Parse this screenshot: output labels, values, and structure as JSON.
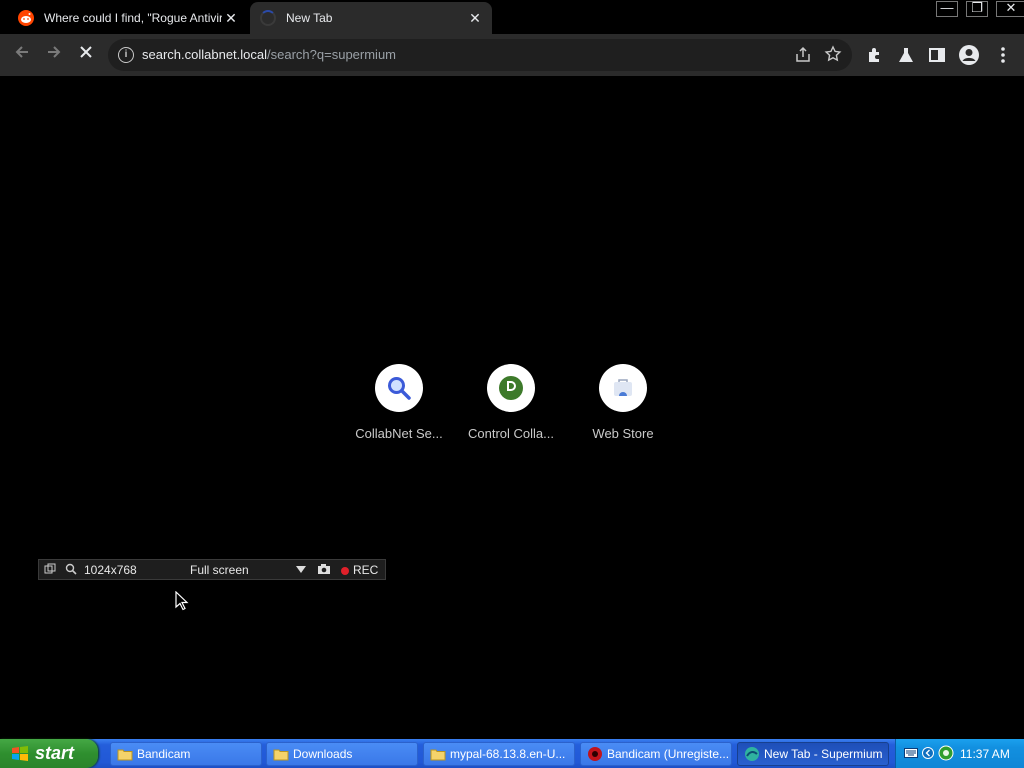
{
  "tabs": [
    {
      "title": "Where could I find, \"Rogue Antiviru",
      "close": "✕",
      "favicon": "reddit-icon"
    },
    {
      "title": "New Tab",
      "close": "✕",
      "favicon": "loading-spinner"
    }
  ],
  "window_controls": {
    "minimize": "—",
    "restore": "❐",
    "close": "✕"
  },
  "omnibox": {
    "domain": "search.collabnet.local",
    "path": "/search?q=supermium"
  },
  "shortcuts": [
    {
      "label": "CollabNet Se...",
      "icon": "search-icon"
    },
    {
      "label": "Control Colla...",
      "icon": "d-logo-icon"
    },
    {
      "label": "Web Store",
      "icon": "web-store-icon"
    }
  ],
  "bandicam": {
    "resolution": "1024x768",
    "mode": "Full screen",
    "rec": "REC"
  },
  "taskbar": {
    "start": "start",
    "items": [
      {
        "label": "Bandicam",
        "icon": "folder-icon"
      },
      {
        "label": "Downloads",
        "icon": "folder-icon"
      },
      {
        "label": "mypal-68.13.8.en-U...",
        "icon": "folder-icon"
      },
      {
        "label": "Bandicam (Unregiste...",
        "icon": "bandicam-icon"
      },
      {
        "label": "New Tab - Supermium",
        "icon": "supermium-icon"
      }
    ],
    "clock": "11:37 AM"
  },
  "colors": {
    "accent": "#2b4aa8",
    "taskbar": "#245edb",
    "start": "#2f8f2f"
  }
}
